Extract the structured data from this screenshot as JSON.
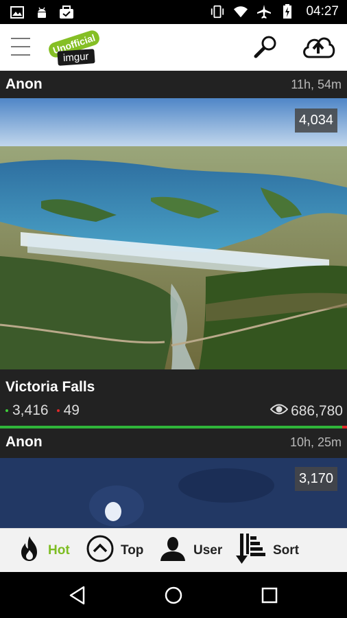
{
  "status_bar": {
    "left_icons": [
      "image-icon",
      "android-icon",
      "download-done-icon"
    ],
    "right_icons": [
      "vibrate-icon",
      "wifi-icon",
      "airplane-icon",
      "battery-charging-icon"
    ],
    "time": "04:27"
  },
  "app_bar": {
    "menu_icon": "hamburger-icon",
    "logo": {
      "unofficial": "Unofficial",
      "brand": "imgur"
    },
    "actions": [
      "search-icon",
      "cloud-upload-icon"
    ]
  },
  "feed": {
    "posts": [
      {
        "author": "Anon",
        "age": "11h, 54m",
        "image_count": "4,034",
        "title": "Victoria Falls",
        "upvotes": "3,416",
        "downvotes": "49",
        "views": "686,780",
        "upvote_ratio": 0.986
      },
      {
        "author": "Anon",
        "age": "10h, 25m",
        "image_count": "3,170"
      }
    ]
  },
  "tabs": [
    {
      "label": "Hot",
      "icon": "flame-icon",
      "active": true
    },
    {
      "label": "Top",
      "icon": "chevron-up-circle-icon",
      "active": false
    },
    {
      "label": "User",
      "icon": "user-icon",
      "active": false
    },
    {
      "label": "Sort",
      "icon": "sort-icon",
      "active": false
    }
  ],
  "nav_bar": [
    "back-icon",
    "home-icon",
    "recents-icon"
  ],
  "colors": {
    "accent": "#85bf25",
    "upvote": "#2fb53a",
    "downvote": "#e02a2a",
    "card_bg": "#222222"
  }
}
